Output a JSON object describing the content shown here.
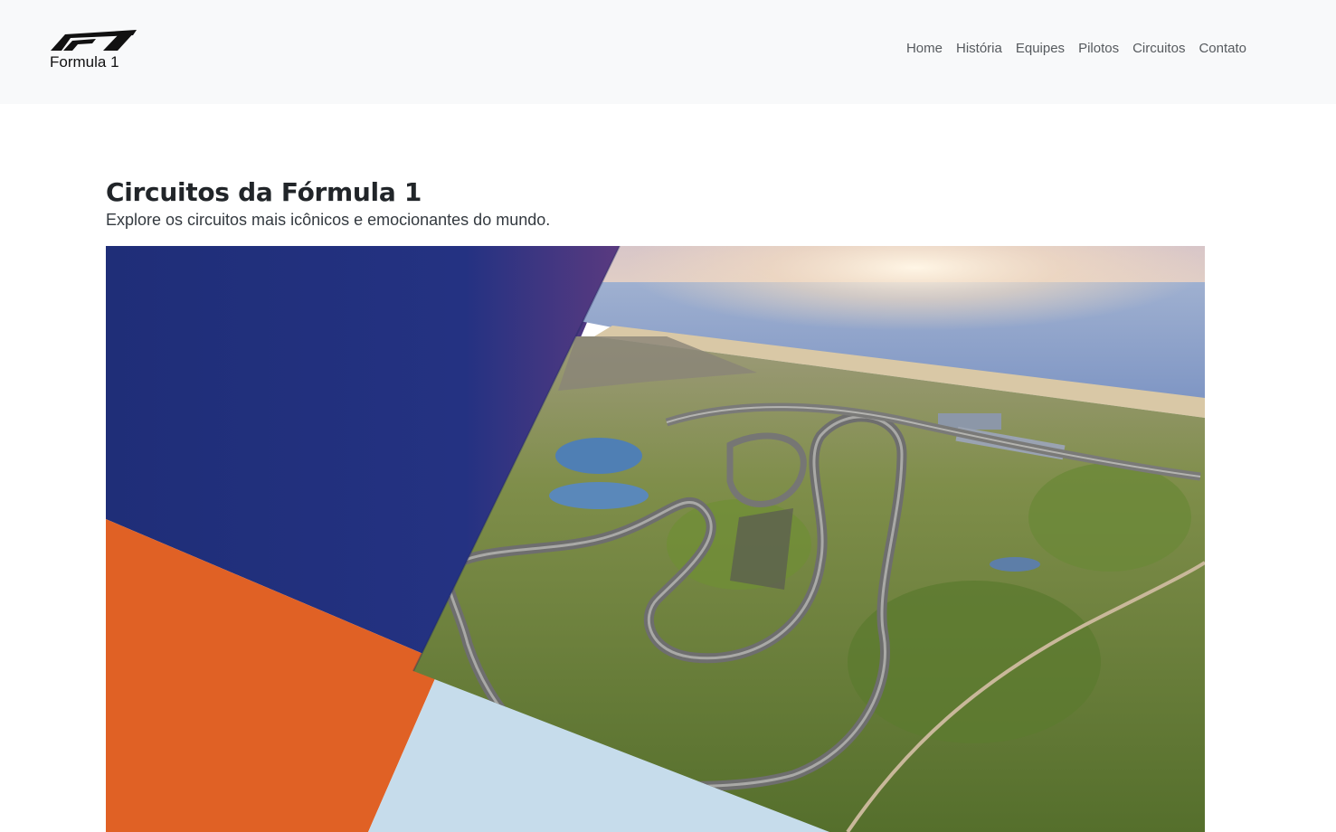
{
  "brand": {
    "logo_icon": "f1-logo-icon",
    "name": "Formula 1"
  },
  "nav": {
    "items": [
      {
        "label": "Home"
      },
      {
        "label": "História"
      },
      {
        "label": "Equipes"
      },
      {
        "label": "Pilotos"
      },
      {
        "label": "Circuitos"
      },
      {
        "label": "Contato"
      }
    ]
  },
  "header": {
    "title": "Circuitos da Fórmula 1",
    "subtitle": "Explore os circuitos mais icônicos e emocionantes do mundo."
  },
  "colors": {
    "navbar_bg": "#f8f9fa",
    "panel_navy": "#22307a",
    "panel_orange": "#e06125",
    "panel_lightblue": "#c6dceb",
    "sea": "#8ea6cc",
    "greenery": "#6c8a3a"
  }
}
